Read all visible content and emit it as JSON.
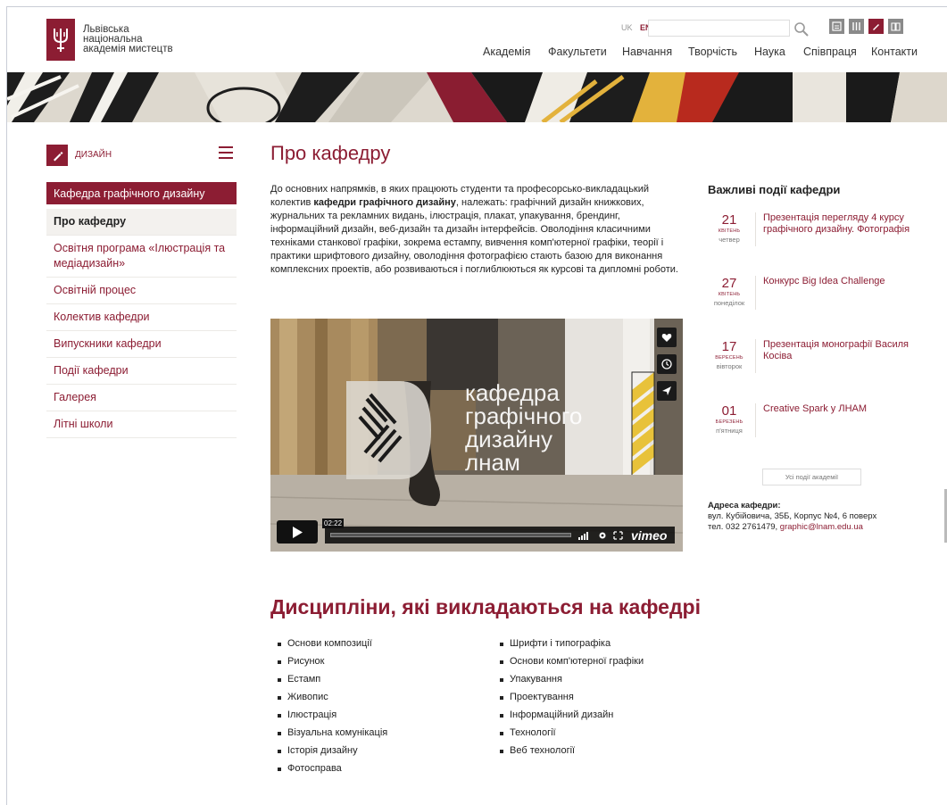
{
  "header": {
    "logo_lines": [
      "Львівська",
      "національна",
      "академія мистецтв"
    ],
    "lang_uk": "UK",
    "lang_en": "EN",
    "search_placeholder": "",
    "nav": [
      "Академія",
      "Факультети",
      "Навчання",
      "Творчість",
      "Наука",
      "Співпраця",
      "Контакти"
    ]
  },
  "sidebar": {
    "department": "дизайн",
    "active_section": "Кафедра графічного дизайну",
    "items": [
      {
        "label": "Про кафедру",
        "current": true
      },
      {
        "label": "Освітня програма «Ілюстрація та медіадизайн»",
        "current": false
      },
      {
        "label": "Освітній процес",
        "current": false
      },
      {
        "label": "Колектив кафедри",
        "current": false
      },
      {
        "label": "Випускники кафедри",
        "current": false
      },
      {
        "label": "Події кафедри",
        "current": false
      },
      {
        "label": "Галерея",
        "current": false
      },
      {
        "label": "Літні школи",
        "current": false
      }
    ]
  },
  "main": {
    "title": "Про кафедру",
    "intro_before": "До основних напрямків, в яких працюють студенти та професорсько-викладацький колектив ",
    "intro_bold": "кафедри графічного дизайну",
    "intro_after": ", належать: графічний дизайн книжкових, журнальних та рекламних видань, ілюстрація, плакат, упакування, брендинг, інформаційний дизайн, веб-дизайн та дизайн інтерфейсів. Оволодіння класичними техніками станкової графіки, зокрема естампу, вивчення комп'ютерної графіки, теорії і практики шрифтового дизайну, оволодіння фотографією стають базою для виконання комплексних проектів, або розвиваються і поглиблюються як курсові та дипломні роботи.",
    "video": {
      "overlay_lines": [
        "кафедра",
        "графічного",
        "дизайну",
        "лнам"
      ],
      "time": "02:22",
      "brand": "vimeo"
    },
    "disciplines_title": "Дисципліни, які викладаються на кафедрі",
    "disciplines_left": [
      "Основи композиції",
      "Рисунок",
      "Естамп",
      "Живопис",
      "Ілюстрація",
      "Візуальна комунікація",
      "Історія дизайну",
      "Фотосправа"
    ],
    "disciplines_right": [
      "Шрифти і типографіка",
      "Основи комп'ютерної графіки",
      "Упакування",
      "Проектування",
      "Інформаційний дизайн",
      "Технології",
      "Веб технології"
    ]
  },
  "events": {
    "title": "Важливі події кафедри",
    "items": [
      {
        "day": "21",
        "month": "квітень",
        "dow": "четвер",
        "title": "Презентація перегляду 4 курсу графічного дизайну. Фотографія"
      },
      {
        "day": "27",
        "month": "квітень",
        "dow": "понеділок",
        "title": "Конкурс Big Idea Challenge"
      },
      {
        "day": "17",
        "month": "вересень",
        "dow": "вівторок",
        "title": "Презентація монографії Василя Косіва"
      },
      {
        "day": "01",
        "month": "березень",
        "dow": "п'ятниця",
        "title": "Creative Spark у ЛНАМ"
      }
    ],
    "all_label": "Усі події академії"
  },
  "address": {
    "label": "Адреса кафедри:",
    "line": "вул. Кубійовича, 35Б, Корпус №4, 6 поверх",
    "phone": "тел. 032 2761479, ",
    "email": "graphic@lnam.edu.ua"
  },
  "colors": {
    "accent": "#8c1d33"
  }
}
